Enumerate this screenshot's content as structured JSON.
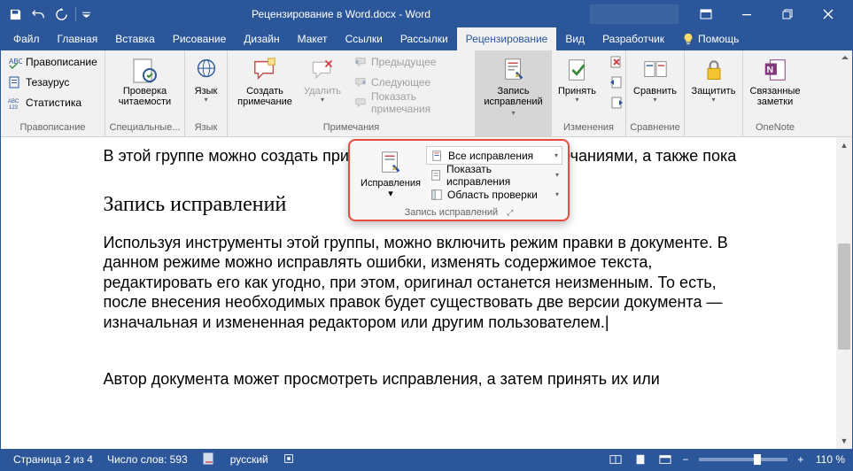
{
  "titlebar": {
    "document_title": "Рецензирование в Word.docx  -  Word"
  },
  "tabs": {
    "file": "Файл",
    "home": "Главная",
    "insert": "Вставка",
    "draw": "Рисование",
    "design": "Дизайн",
    "layout": "Макет",
    "references": "Ссылки",
    "mailings": "Рассылки",
    "review": "Рецензирование",
    "view": "Вид",
    "developer": "Разработчик",
    "help": "Помощь"
  },
  "ribbon": {
    "proofing": {
      "group_label": "Правописание",
      "spelling": "Правописание",
      "thesaurus": "Тезаурус",
      "statistics": "Статистика"
    },
    "accessibility": {
      "group_label": "Специальные...",
      "check_accessibility_l1": "Проверка",
      "check_accessibility_l2": "читаемости"
    },
    "language": {
      "group_label": "Язык",
      "language": "Язык"
    },
    "comments": {
      "group_label": "Примечания",
      "new_comment_l1": "Создать",
      "new_comment_l2": "примечание",
      "delete": "Удалить",
      "previous": "Предыдущее",
      "next": "Следующее",
      "show_comments": "Показать примечания"
    },
    "tracking": {
      "group_label": "",
      "track_changes_l1": "Запись",
      "track_changes_l2": "исправлений"
    },
    "changes": {
      "group_label": "Изменения",
      "accept": "Принять"
    },
    "compare": {
      "group_label": "Сравнение",
      "compare": "Сравнить"
    },
    "protect": {
      "group_label": "",
      "protect": "Защитить"
    },
    "onenote": {
      "group_label": "OneNote",
      "linked_notes_l1": "Связанные",
      "linked_notes_l2": "заметки"
    }
  },
  "callout": {
    "track_changes": "Исправления",
    "display_for_review": "Все исправления",
    "show_markup": "Показать исправления",
    "reviewing_pane": "Область проверки",
    "group_label": "Запись исправлений"
  },
  "document": {
    "para1": "В этой группе можно создать примечание, имеющимися примечаниями, а также пока",
    "heading": "Запись исправлений",
    "para2": "Используя инструменты этой группы, можно включить режим правки в документе. В данном режиме можно исправлять ошибки, изменять содержимое текста, редактировать его как угодно, при этом, оригинал останется неизменным. То есть, после внесения необходимых правок будет существовать две версии документа — изначальная и измененная редактором или другим пользователем.",
    "para3": "Автор документа может просмотреть исправления, а затем принять их или"
  },
  "statusbar": {
    "page": "Страница 2 из 4",
    "words": "Число слов: 593",
    "language": "русский",
    "zoom": "110 %"
  }
}
